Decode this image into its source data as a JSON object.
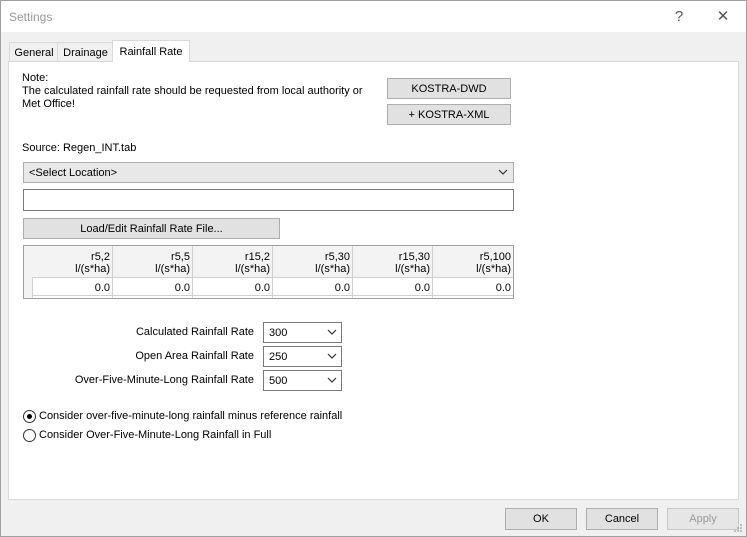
{
  "window": {
    "title": "Settings",
    "help_glyph": "?",
    "close_glyph": "✕"
  },
  "tabs": [
    {
      "label": "General",
      "active": false
    },
    {
      "label": "Drainage",
      "active": false
    },
    {
      "label": "Rainfall Rate",
      "active": true
    }
  ],
  "note": {
    "heading": "Note:",
    "line1": "The calculated rainfall rate should be requested from local authority or",
    "line2": "Met Office!"
  },
  "buttons": {
    "kostra_dwd": "KOSTRA-DWD",
    "kostra_xml": "+ KOSTRA-XML",
    "load_edit": "Load/Edit Rainfall Rate File..."
  },
  "source_label": "Source: Regen_INT.tab",
  "location_select": {
    "value": "<Select Location>"
  },
  "text_field": {
    "value": ""
  },
  "rate_table": {
    "columns": [
      {
        "name": "r5,2",
        "unit": "l/(s*ha)",
        "value": "0.0"
      },
      {
        "name": "r5,5",
        "unit": "l/(s*ha)",
        "value": "0.0"
      },
      {
        "name": "r15,2",
        "unit": "l/(s*ha)",
        "value": "0.0"
      },
      {
        "name": "r5,30",
        "unit": "l/(s*ha)",
        "value": "0.0"
      },
      {
        "name": "r15,30",
        "unit": "l/(s*ha)",
        "value": "0.0"
      },
      {
        "name": "r5,100",
        "unit": "l/(s*ha)",
        "value": "0.0"
      }
    ]
  },
  "rates": {
    "calculated": {
      "label": "Calculated Rainfall Rate",
      "value": "300"
    },
    "open_area": {
      "label": "Open Area Rainfall Rate",
      "value": "250"
    },
    "over_five": {
      "label": "Over-Five-Minute-Long Rainfall Rate",
      "value": "500"
    }
  },
  "radios": {
    "minus_reference": {
      "label": "Consider over-five-minute-long rainfall minus reference rainfall",
      "checked": true
    },
    "in_full": {
      "label": "Consider Over-Five-Minute-Long Rainfall in Full",
      "checked": false
    }
  },
  "footer": {
    "ok": "OK",
    "cancel": "Cancel",
    "apply": "Apply"
  }
}
